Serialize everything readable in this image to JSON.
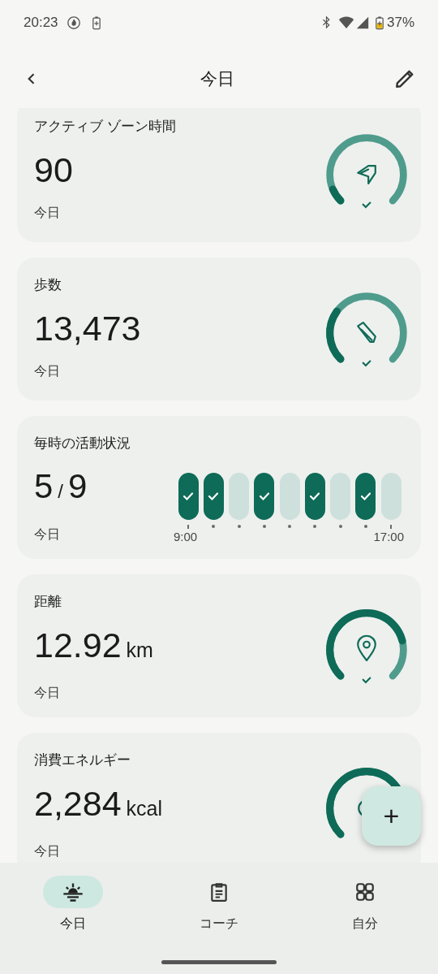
{
  "status_bar": {
    "time": "20:23",
    "battery": "37%"
  },
  "header": {
    "title": "今日"
  },
  "cards": [
    {
      "kind": "active",
      "title": "アクティブ ゾーン時間",
      "value": "90",
      "subtitle": "今日"
    },
    {
      "kind": "steps",
      "title": "歩数",
      "value": "13,473",
      "subtitle": "今日"
    },
    {
      "kind": "hourly",
      "title": "毎時の活動状況",
      "value": "5",
      "separator": "/",
      "total": "9",
      "subtitle": "今日",
      "start_label": "9:00",
      "end_label": "17:00",
      "hours": [
        {
          "active": true
        },
        {
          "active": true
        },
        {
          "active": false
        },
        {
          "active": true
        },
        {
          "active": false
        },
        {
          "active": true
        },
        {
          "active": false
        },
        {
          "active": true
        },
        {
          "active": false
        }
      ]
    },
    {
      "kind": "distance",
      "title": "距離",
      "value": "12.92",
      "unit": "km",
      "subtitle": "今日"
    },
    {
      "kind": "energy",
      "title": "消費エネルギー",
      "value": "2,284",
      "unit": "kcal",
      "subtitle": "今日"
    }
  ],
  "fab": {
    "label": "+"
  },
  "nav": [
    {
      "label": "今日",
      "selected": true
    },
    {
      "label": "コーチ",
      "selected": false
    },
    {
      "label": "自分",
      "selected": false
    }
  ]
}
